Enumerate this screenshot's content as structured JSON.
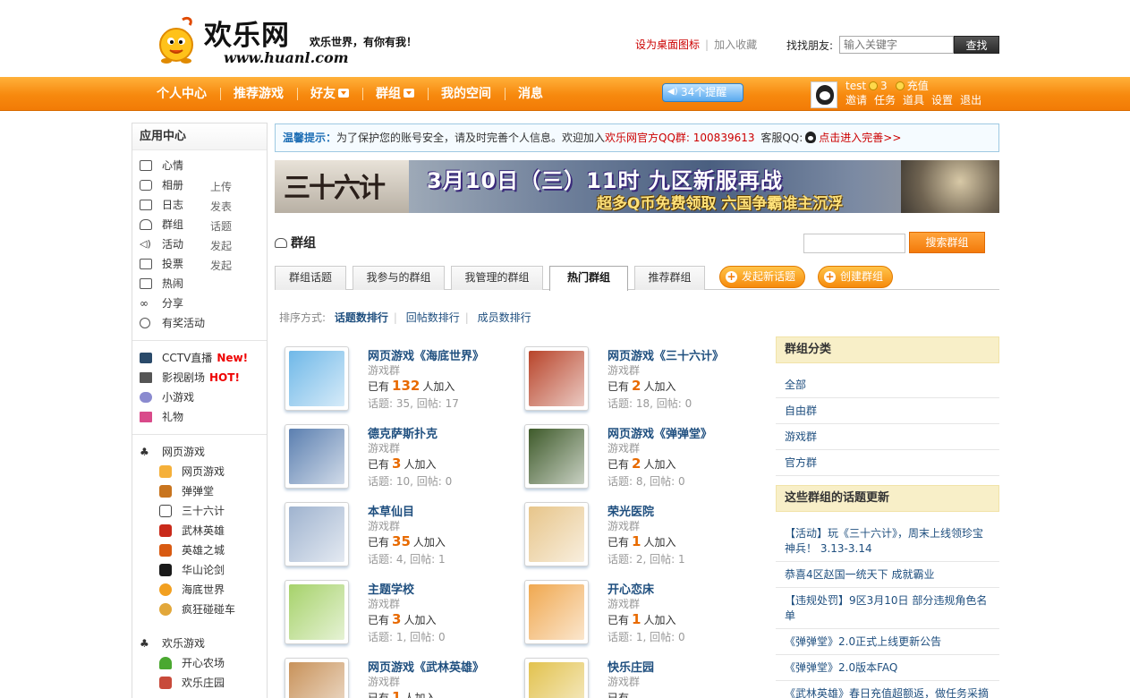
{
  "header": {
    "logo_name": "欢乐网",
    "logo_slogan": "欢乐世界，有你有我！",
    "logo_url": "www.huanl.com",
    "link_desktop": "设为桌面图标",
    "link_fav": "加入收藏",
    "find_label": "找找朋友:",
    "find_placeholder": "输入关键字",
    "find_button": "查找"
  },
  "nav": {
    "items": [
      "个人中心",
      "推荐游戏",
      "好友",
      "群组",
      "我的空间",
      "消息"
    ],
    "remind": "34个提醒",
    "user": {
      "name": "test",
      "coins": "3",
      "recharge": "充值",
      "actions": [
        "邀请",
        "任务",
        "道具",
        "设置",
        "退出"
      ]
    }
  },
  "sidebar": {
    "title": "应用中心",
    "apps": [
      {
        "label": "心情",
        "extra": ""
      },
      {
        "label": "相册",
        "extra": "上传"
      },
      {
        "label": "日志",
        "extra": "发表"
      },
      {
        "label": "群组",
        "extra": "话题"
      },
      {
        "label": "活动",
        "extra": "发起"
      },
      {
        "label": "投票",
        "extra": "发起"
      },
      {
        "label": "热闹",
        "extra": ""
      },
      {
        "label": "分享",
        "extra": ""
      },
      {
        "label": "有奖活动",
        "extra": ""
      }
    ],
    "media": [
      {
        "label": "CCTV直播",
        "tag": "New!"
      },
      {
        "label": "影视剧场",
        "tag": "HOT!"
      },
      {
        "label": "小游戏",
        "tag": ""
      },
      {
        "label": "礼物",
        "tag": ""
      }
    ],
    "web_games_title": "网页游戏",
    "web_games": [
      "网页游戏",
      "弹弹堂",
      "三十六计",
      "武林英雄",
      "英雄之城",
      "华山论剑",
      "海底世界",
      "疯狂碰碰车"
    ],
    "fun_games_title": "欢乐游戏",
    "fun_games": [
      "开心农场",
      "欢乐庄园"
    ]
  },
  "tip": {
    "label": "温馨提示：",
    "text": "为了保护您的账号安全，请及时完善个人信息。欢迎加入",
    "qq_group": "欢乐网官方QQ群: 100839613",
    "service": "客服QQ:",
    "link": "点击进入完善>>"
  },
  "banner": {
    "logo": "三十六计",
    "headline": "3月10日（三）11时 九区新服再战",
    "sub": "超多Q币免费领取 六国争霸谁主沉浮"
  },
  "groups_section": {
    "title": "群组",
    "search_button": "搜索群组",
    "tabs": [
      "群组话题",
      "我参与的群组",
      "我管理的群组",
      "热门群组",
      "推荐群组"
    ],
    "active_tab": "热门群组",
    "new_topic": "发起新话题",
    "create_group": "创建群组",
    "sort_label": "排序方式:",
    "sort_options": [
      "话题数排行",
      "回帖数排行",
      "成员数排行"
    ]
  },
  "groups": [
    {
      "name": "网页游戏《海底世界》",
      "type": "游戏群",
      "pre": "已有",
      "members": "132",
      "post": "人加入",
      "stats": "话题: 35, 回帖: 17",
      "color": "#6fb8e8"
    },
    {
      "name": "网页游戏《三十六计》",
      "type": "游戏群",
      "pre": "已有",
      "members": "2",
      "post": "人加入",
      "stats": "话题: 18, 回帖: 0",
      "color": "#b8442a"
    },
    {
      "name": "德克萨斯扑克",
      "type": "游戏群",
      "pre": "已有",
      "members": "3",
      "post": "人加入",
      "stats": "话题: 10, 回帖: 0",
      "color": "#5b7fb0"
    },
    {
      "name": "网页游戏《弹弹堂》",
      "type": "游戏群",
      "pre": "已有",
      "members": "2",
      "post": "人加入",
      "stats": "话题: 8, 回帖: 0",
      "color": "#3e5a2a"
    },
    {
      "name": "本草仙目",
      "type": "游戏群",
      "pre": "已有",
      "members": "35",
      "post": "人加入",
      "stats": "话题: 4, 回帖: 1",
      "color": "#9fb3cf"
    },
    {
      "name": "荣光医院",
      "type": "游戏群",
      "pre": "已有",
      "members": "1",
      "post": "人加入",
      "stats": "话题: 2, 回帖: 1",
      "color": "#e7c58a"
    },
    {
      "name": "主题学校",
      "type": "游戏群",
      "pre": "已有",
      "members": "3",
      "post": "人加入",
      "stats": "话题: 1, 回帖: 0",
      "color": "#a6d26a"
    },
    {
      "name": "开心恋床",
      "type": "游戏群",
      "pre": "已有",
      "members": "1",
      "post": "人加入",
      "stats": "话题: 1, 回帖: 0",
      "color": "#f0a850"
    },
    {
      "name": "网页游戏《武林英雄》",
      "type": "游戏群",
      "pre": "已有",
      "members": "1",
      "post": "人加入",
      "stats": "",
      "color": "#c8925a"
    },
    {
      "name": "快乐庄园",
      "type": "游戏群",
      "pre": "已有",
      "members": "",
      "post": "",
      "stats": "",
      "color": "#e2c24e"
    }
  ],
  "right": {
    "cat_title": "群组分类",
    "categories": [
      "全部",
      "自由群",
      "游戏群",
      "官方群"
    ],
    "updates_title": "这些群组的话题更新",
    "updates": [
      "【活动】玩《三十六计》，周末上线领珍宝神兵！ 3.13-3.14",
      "恭喜4区赵国一统天下 成就霸业",
      "【违规处罚】9区3月10日 部分违规角色名单",
      "《弹弹堂》2.0正式上线更新公告",
      "《弹弹堂》2.0版本FAQ",
      "《武林英雄》春日充值超额返，做任务采摘"
    ]
  },
  "colors": {
    "nav_orange": "#f7890e",
    "link_blue": "#1f4f7f",
    "accent_red": "#cc0000",
    "member_orange": "#e86a00"
  }
}
